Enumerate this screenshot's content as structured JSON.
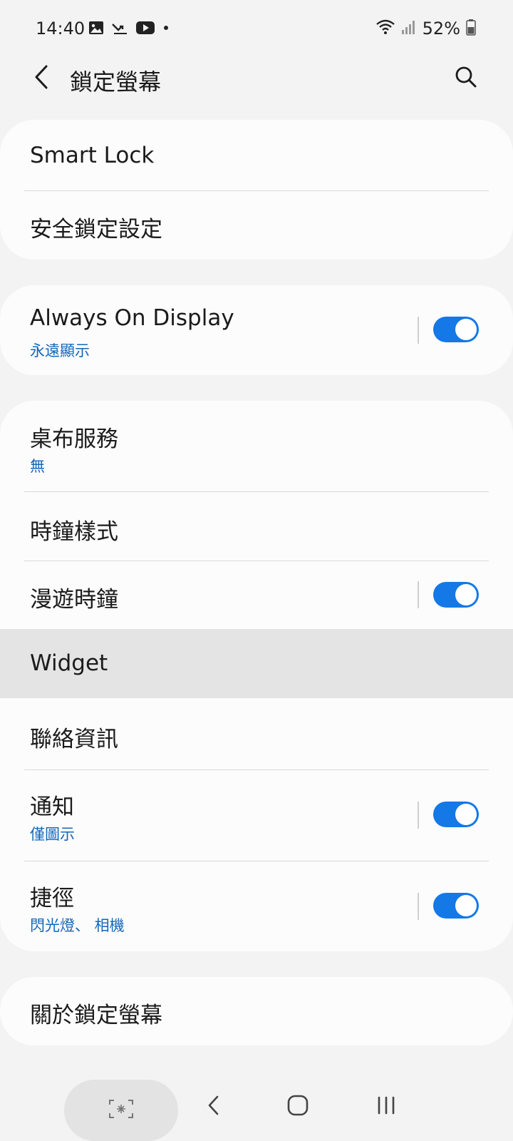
{
  "status_bar": {
    "time": "14:40",
    "battery": "52%"
  },
  "header": {
    "title": "鎖定螢幕"
  },
  "cards": {
    "security": {
      "smart_lock": "Smart Lock",
      "secure_lock": "安全鎖定設定"
    },
    "aod": {
      "title": "Always On Display",
      "subtitle": "永遠顯示",
      "enabled": true
    },
    "main": {
      "wallpaper": {
        "title": "桌布服務",
        "subtitle": "無"
      },
      "clock_style": {
        "title": "時鐘樣式"
      },
      "roaming_clock": {
        "title": "漫遊時鐘",
        "enabled": true
      },
      "widget": {
        "title": "Widget"
      },
      "contact_info": {
        "title": "聯絡資訊"
      },
      "notifications": {
        "title": "通知",
        "subtitle": "僅圖示",
        "enabled": true
      },
      "shortcuts": {
        "title": "捷徑",
        "subtitle": "閃光燈、 相機",
        "enabled": true
      }
    },
    "about": {
      "title": "關於鎖定螢幕"
    }
  },
  "colors": {
    "accent": "#1478e6",
    "subtitle": "#1466b8",
    "background": "#f3f3f3",
    "card": "#fcfcfc",
    "highlight": "#e4e4e4"
  },
  "icons": {
    "back": "chevron-left-icon",
    "search": "search-icon",
    "gallery": "image-icon",
    "missed_call": "missed-call-icon",
    "youtube": "youtube-icon",
    "wifi": "wifi-icon",
    "signal": "signal-icon",
    "battery": "battery-icon"
  }
}
